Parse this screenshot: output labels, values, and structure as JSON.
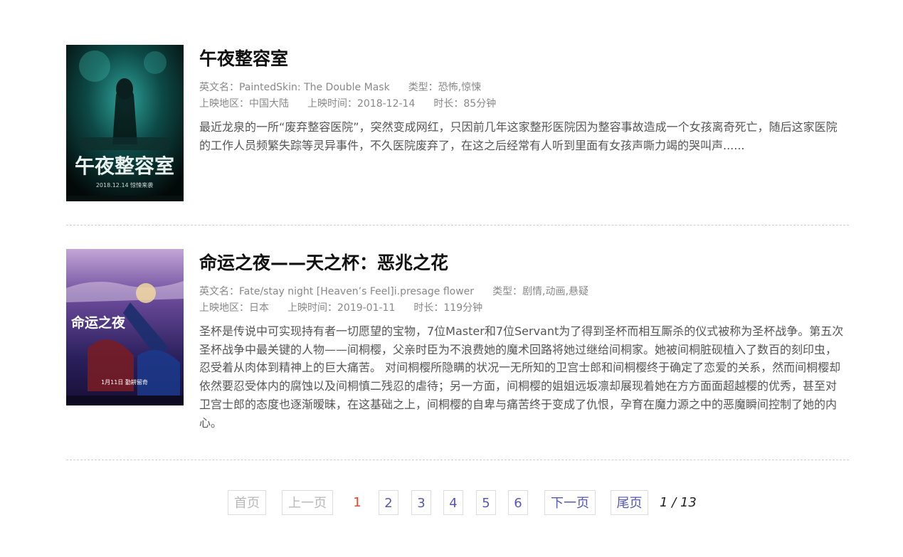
{
  "movies": [
    {
      "title": "午夜整容室",
      "en_label": "英文名：",
      "en_name": "PaintedSkin: The Double Mask",
      "genre_label": "类型：",
      "genre": "恐怖,惊悚",
      "region_label": "上映地区：",
      "region": "中国大陆",
      "date_label": "上映时间：",
      "date": "2018-12-14",
      "duration_label": "时长：",
      "duration": "85分钟",
      "description": "最近龙泉的一所“废弃整容医院”，突然变成网红，只因前几年这家整形医院因为整容事故造成一个女孩离奇死亡，随后这家医院的工作人员频繁失踪等灵异事件，不久医院废弃了，在这之后经常有人听到里面有女孩声嘶力竭的哭叫声......",
      "poster": {
        "title_text": "午夜整容室",
        "date_text": "2018.12.14  惊悚来袭",
        "colors": [
          "#0b3b3a",
          "#1f8b84",
          "#050a0a"
        ]
      }
    },
    {
      "title": "命运之夜——天之杯：恶兆之花",
      "en_label": "英文名：",
      "en_name": "Fate/stay night [Heaven’s Feel]i.presage flower",
      "genre_label": "类型：",
      "genre": "剧情,动画,悬疑",
      "region_label": "上映地区：",
      "region": "日本",
      "date_label": "上映时间：",
      "date": "2019-01-11",
      "duration_label": "时长：",
      "duration": "119分钟",
      "description": "圣杯是传说中可实现持有者一切愿望的宝物，7位Master和7位Servant为了得到圣杯而相互厮杀的仪式被称为圣杯战争。第五次圣杯战争中最关键的人物——间桐樱，父亲时臣为不浪费她的魔术回路将她过继给间桐家。她被间桐脏砚植入了数百的刻印虫，忍受着从肉体到精神上的巨大痛苦。 对间桐樱所隐瞒的状况一无所知的卫宫士郎和间桐樱终于确定了恋爱的关系，然而间桐樱却依然要忍受体内的腐蚀以及间桐慎二残忍的虐待；另一方面，间桐樱的姐姐远坂凛却展现着她在方方面面超越樱的优秀，甚至对卫宫士郎的态度也逐渐暧昧，在这基础之上，间桐樱的自卑与痛苦终于变成了仇恨，孕育在魔力源之中的恶魔瞬间控制了她的内心。",
      "poster": {
        "title_text": "命运之夜",
        "date_text": "1月11日 勤耕留奇",
        "colors": [
          "#2a1f5c",
          "#6a4a9a",
          "#c9a7d8"
        ]
      }
    }
  ],
  "pagination": {
    "first": "首页",
    "prev": "上一页",
    "current": "1",
    "pages": [
      "2",
      "3",
      "4",
      "5",
      "6"
    ],
    "next": "下一页",
    "last": "尾页",
    "count": "1 / 13"
  }
}
